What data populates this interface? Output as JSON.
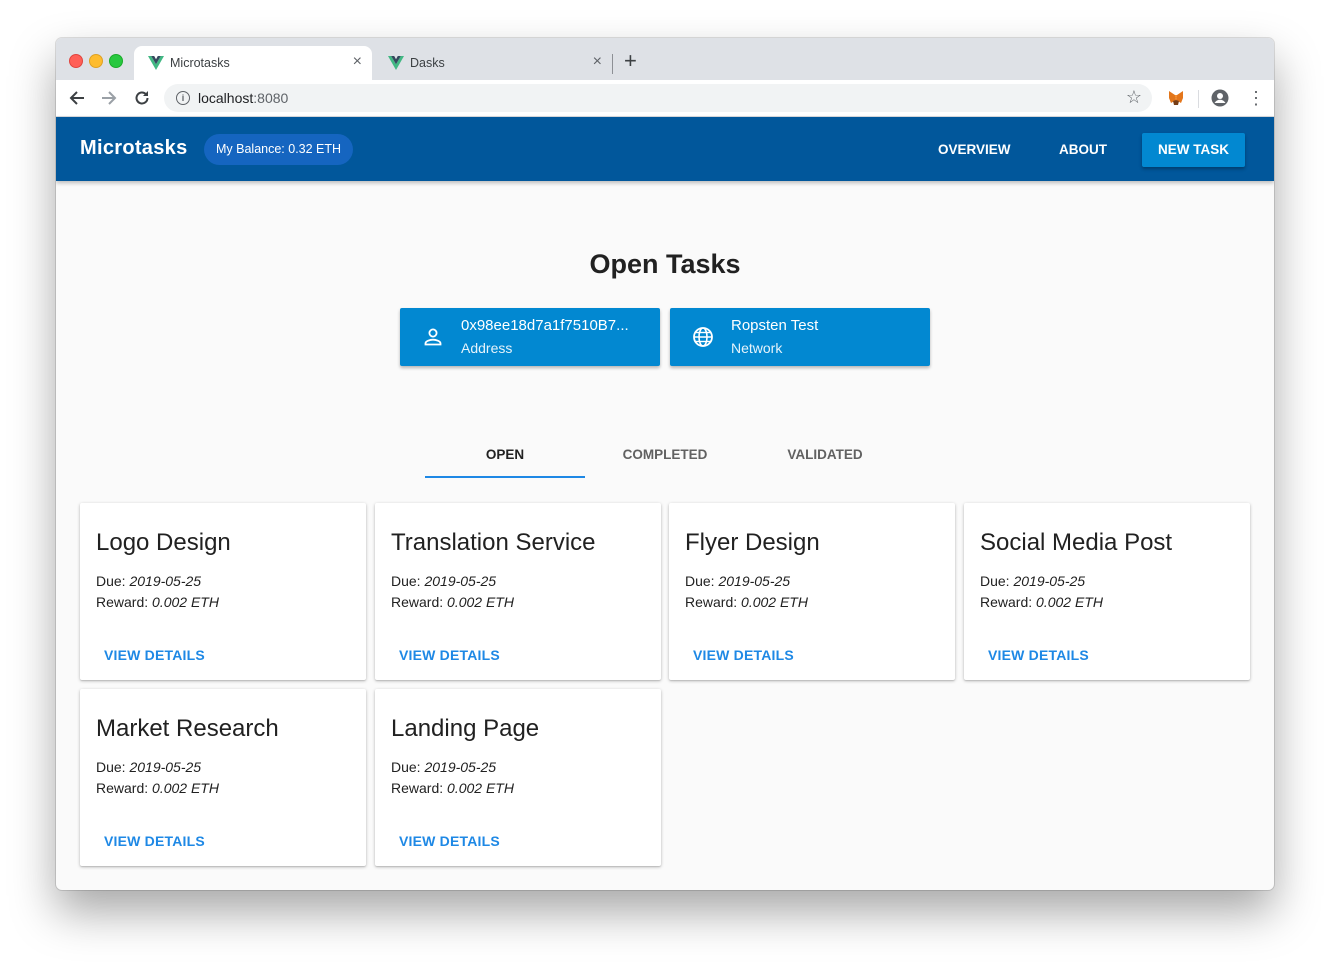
{
  "browser": {
    "tabs": [
      {
        "title": "Microtasks",
        "active": true
      },
      {
        "title": "Dasks",
        "active": false
      }
    ],
    "url_host": "localhost",
    "url_port": ":8080",
    "close_glyph": "×",
    "new_tab_glyph": "+"
  },
  "appbar": {
    "title": "Microtasks",
    "balance": "My Balance: 0.32 ETH",
    "nav": {
      "overview": "OVERVIEW",
      "about": "ABOUT",
      "new_task": "NEW TASK"
    },
    "color": "#01579b"
  },
  "page": {
    "title": "Open Tasks",
    "info_cards": [
      {
        "primary": "0x98ee18d7a1f7510B7...",
        "secondary": "Address",
        "icon": "account-icon"
      },
      {
        "primary": "Ropsten Test",
        "secondary": "Network",
        "icon": "globe-icon"
      }
    ],
    "tabs": [
      "OPEN",
      "COMPLETED",
      "VALIDATED"
    ],
    "active_tab": "OPEN"
  },
  "labels": {
    "due": "Due:",
    "reward": "Reward:",
    "view": "VIEW DETAILS"
  },
  "tasks": [
    {
      "name": "Logo Design",
      "due": "2019-05-25",
      "reward": "0.002 ETH"
    },
    {
      "name": "Translation Service",
      "due": "2019-05-25",
      "reward": "0.002 ETH"
    },
    {
      "name": "Flyer Design",
      "due": "2019-05-25",
      "reward": "0.002 ETH"
    },
    {
      "name": "Social Media Post",
      "due": "2019-05-25",
      "reward": "0.002 ETH"
    },
    {
      "name": "Market Research",
      "due": "2019-05-25",
      "reward": "0.002 ETH"
    },
    {
      "name": "Landing Page",
      "due": "2019-05-25",
      "reward": "0.002 ETH"
    }
  ],
  "colors": {
    "accent": "#0288d1",
    "link": "#1e88e5"
  }
}
